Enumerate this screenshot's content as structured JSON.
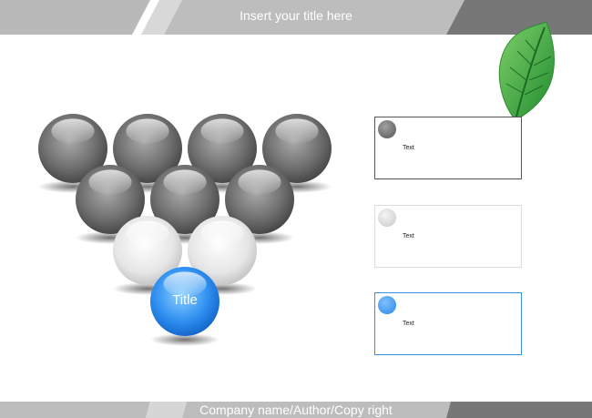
{
  "header": {
    "title": "Insert your title here"
  },
  "footer": {
    "text": "Company name/Author/Copy right"
  },
  "diagram": {
    "title_ball_label": "Title",
    "rows": [
      [
        "dark",
        "dark",
        "dark",
        "dark"
      ],
      [
        "dark",
        "dark",
        "dark"
      ],
      [
        "light",
        "light"
      ],
      [
        "blue"
      ]
    ]
  },
  "text_boxes": [
    {
      "label": "Text",
      "color": "#6d6d6d"
    },
    {
      "label": "Text",
      "color": "#dedede"
    },
    {
      "label": "Text",
      "color": "#4aa3f5"
    }
  ],
  "colors": {
    "band_dark": "#6e6e6e",
    "band_light": "#bdbdbd",
    "accent_blue": "#2a86e8",
    "leaf_green": "#3aa53a"
  },
  "decoration": {
    "icon": "leaf-icon"
  }
}
